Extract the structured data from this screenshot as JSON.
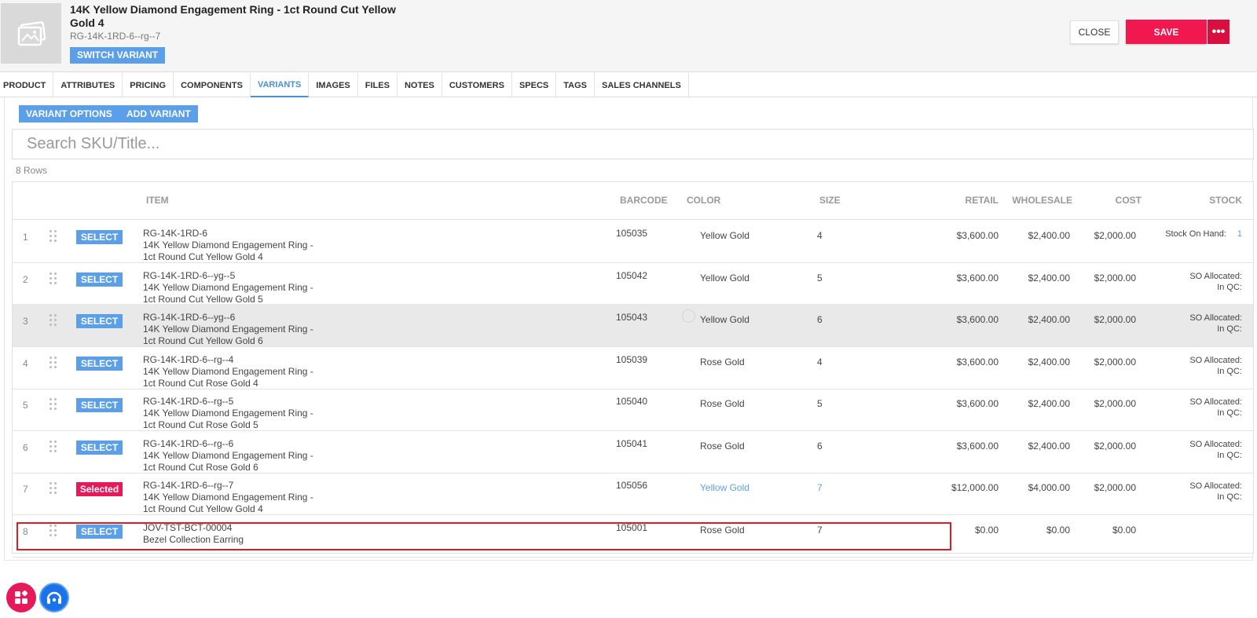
{
  "header": {
    "title": "14K Yellow Diamond Engagement Ring - 1ct Round Cut Yellow Gold 4",
    "sku": "RG-14K-1RD-6--rg--7",
    "switch_label": "SWITCH VARIANT",
    "close_label": "CLOSE",
    "save_label": "SAVE",
    "more_label": "•••"
  },
  "tabs": [
    "PRODUCT",
    "ATTRIBUTES",
    "PRICING",
    "COMPONENTS",
    "VARIANTS",
    "IMAGES",
    "FILES",
    "NOTES",
    "CUSTOMERS",
    "SPECS",
    "TAGS",
    "SALES CHANNELS"
  ],
  "active_tab": "VARIANTS",
  "toolbar": {
    "variant_options_label": "VARIANT OPTIONS",
    "add_variant_label": "ADD VARIANT",
    "search_placeholder": "Search SKU/Title...",
    "rows_count": "8 Rows"
  },
  "columns": {
    "item": "ITEM",
    "barcode": "BARCODE",
    "color": "COLOR",
    "size": "SIZE",
    "retail": "RETAIL",
    "wholesale": "WHOLESALE",
    "cost": "COST",
    "stock": "STOCK"
  },
  "rows": [
    {
      "num": "1",
      "button": "SELECT",
      "sku": "RG-14K-1RD-6",
      "name1": "14K Yellow Diamond Engagement Ring -",
      "name2": "1ct Round Cut Yellow Gold 4",
      "barcode": "105035",
      "color": "Yellow Gold",
      "size": "4",
      "retail": "$3,600.00",
      "wholesale": "$2,400.00",
      "cost": "$2,000.00",
      "stock1": "Stock On Hand:",
      "stock_qty": "1",
      "stock2": ""
    },
    {
      "num": "2",
      "button": "SELECT",
      "sku": "RG-14K-1RD-6--yg--5",
      "name1": "14K Yellow Diamond Engagement Ring -",
      "name2": "1ct Round Cut Yellow Gold 5",
      "barcode": "105042",
      "color": "Yellow Gold",
      "size": "5",
      "retail": "$3,600.00",
      "wholesale": "$2,400.00",
      "cost": "$2,000.00",
      "stock1": "SO Allocated:",
      "stock_qty": "",
      "stock2": "In QC:"
    },
    {
      "num": "3",
      "button": "SELECT",
      "sku": "RG-14K-1RD-6--yg--6",
      "name1": "14K Yellow Diamond Engagement Ring -",
      "name2": "1ct Round Cut Yellow Gold 6",
      "barcode": "105043",
      "color": "Yellow Gold",
      "size": "6",
      "retail": "$3,600.00",
      "wholesale": "$2,400.00",
      "cost": "$2,000.00",
      "stock1": "SO Allocated:",
      "stock_qty": "",
      "stock2": "In QC:"
    },
    {
      "num": "4",
      "button": "SELECT",
      "sku": "RG-14K-1RD-6--rg--4",
      "name1": "14K Yellow Diamond Engagement Ring -",
      "name2": "1ct Round Cut Rose Gold 4",
      "barcode": "105039",
      "color": "Rose Gold",
      "size": "4",
      "retail": "$3,600.00",
      "wholesale": "$2,400.00",
      "cost": "$2,000.00",
      "stock1": "SO Allocated:",
      "stock_qty": "",
      "stock2": "In QC:"
    },
    {
      "num": "5",
      "button": "SELECT",
      "sku": "RG-14K-1RD-6--rg--5",
      "name1": "14K Yellow Diamond Engagement Ring -",
      "name2": "1ct Round Cut Rose Gold 5",
      "barcode": "105040",
      "color": "Rose Gold",
      "size": "5",
      "retail": "$3,600.00",
      "wholesale": "$2,400.00",
      "cost": "$2,000.00",
      "stock1": "SO Allocated:",
      "stock_qty": "",
      "stock2": "In QC:"
    },
    {
      "num": "6",
      "button": "SELECT",
      "sku": "RG-14K-1RD-6--rg--6",
      "name1": "14K Yellow Diamond Engagement Ring -",
      "name2": "1ct Round Cut Rose Gold 6",
      "barcode": "105041",
      "color": "Rose Gold",
      "size": "6",
      "retail": "$3,600.00",
      "wholesale": "$2,400.00",
      "cost": "$2,000.00",
      "stock1": "SO Allocated:",
      "stock_qty": "",
      "stock2": "In QC:"
    },
    {
      "num": "7",
      "button": "Selected",
      "sku": "RG-14K-1RD-6--rg--7",
      "name1": "14K Yellow Diamond Engagement Ring -",
      "name2": "1ct Round Cut Yellow Gold 4",
      "barcode": "105056",
      "color": "Yellow Gold",
      "size": "7",
      "retail": "$12,000.00",
      "wholesale": "$4,000.00",
      "cost": "$2,000.00",
      "stock1": "SO Allocated:",
      "stock_qty": "",
      "stock2": "In QC:"
    },
    {
      "num": "8",
      "button": "SELECT",
      "sku": "JOV-TST-BCT-00004",
      "name1": "Bezel Collection Earring",
      "name2": "",
      "barcode": "105001",
      "color": "Rose Gold",
      "size": "7",
      "retail": "$0.00",
      "wholesale": "$0.00",
      "cost": "$0.00",
      "stock1": "",
      "stock_qty": "",
      "stock2": ""
    }
  ],
  "colors": {
    "accent": "#5b9fe8",
    "save": "#f0184e",
    "selected_badge": "#e8195a",
    "highlight_frame": "#e01b24"
  },
  "icons": {
    "thumb": "image-placeholder-icon",
    "drag": "drag-handle-icon",
    "fab_left": "apps-grid-icon",
    "fab_right": "headset-support-icon"
  }
}
